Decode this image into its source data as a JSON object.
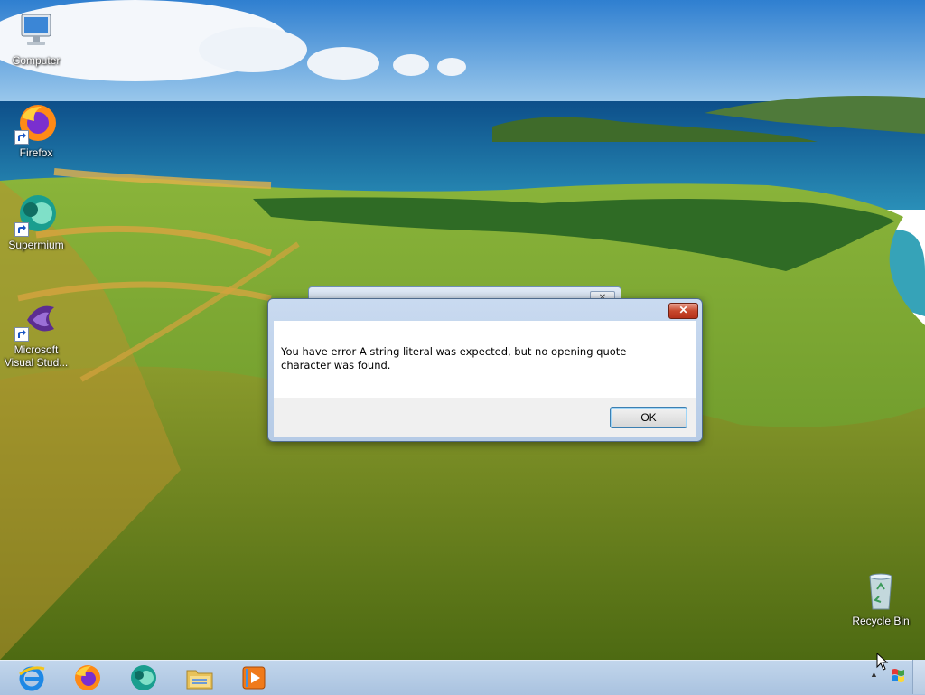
{
  "desktop": {
    "icons": [
      {
        "label": "Computer",
        "icon": "computer-icon"
      },
      {
        "label": "Firefox",
        "icon": "firefox-icon"
      },
      {
        "label": "Supermium",
        "icon": "supermium-icon"
      },
      {
        "label": "Microsoft Visual Stud...",
        "icon": "visual-studio-icon"
      },
      {
        "label": "Recycle Bin",
        "icon": "recycle-bin-icon"
      }
    ]
  },
  "dialog": {
    "message": "You have error A string literal was expected, but no opening quote character was found.",
    "ok_label": "OK",
    "close_glyph": "✕"
  },
  "background_window": {
    "close_glyph": "✕"
  },
  "taskbar": {
    "items": [
      {
        "icon": "internet-explorer-icon"
      },
      {
        "icon": "firefox-icon"
      },
      {
        "icon": "supermium-icon"
      },
      {
        "icon": "file-explorer-icon"
      },
      {
        "icon": "media-player-icon"
      }
    ],
    "tray_arrow": "▲"
  },
  "colors": {
    "taskbar": "#b3c9e3",
    "dialog_frame": "#b6cbe6",
    "close_button": "#c7472c"
  }
}
